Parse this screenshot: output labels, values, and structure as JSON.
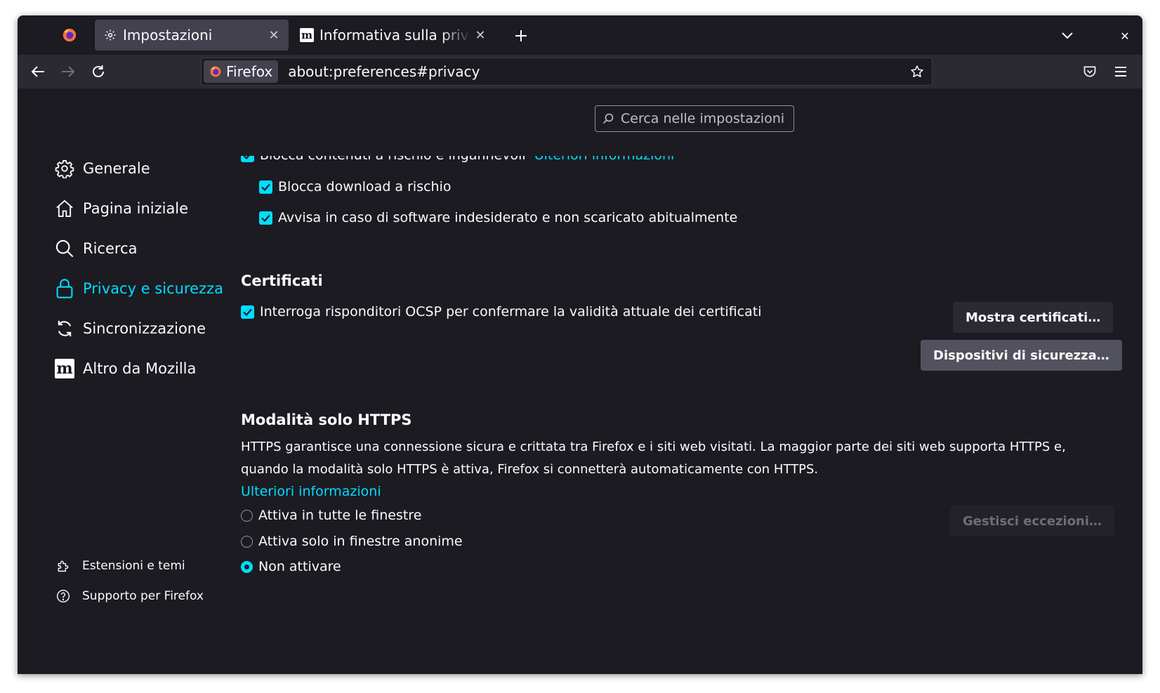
{
  "tabs": [
    {
      "title": "Impostazioni",
      "icon": "gear-icon"
    },
    {
      "title": "Informativa sulla privacy",
      "icon": "mozilla-m-icon"
    }
  ],
  "urlbar": {
    "identity_label": "Firefox",
    "url": "about:preferences#privacy"
  },
  "search": {
    "placeholder": "Cerca nelle impostazioni"
  },
  "sidebar": {
    "items": [
      {
        "label": "Generale",
        "icon": "gear-icon"
      },
      {
        "label": "Pagina iniziale",
        "icon": "home-icon"
      },
      {
        "label": "Ricerca",
        "icon": "search-icon"
      },
      {
        "label": "Privacy e sicurezza",
        "icon": "lock-icon",
        "selected": true
      },
      {
        "label": "Sincronizzazione",
        "icon": "sync-icon"
      },
      {
        "label": "Altro da Mozilla",
        "icon": "mozilla-m-icon"
      }
    ],
    "footer": [
      {
        "label": "Estensioni e temi",
        "icon": "puzzle-icon"
      },
      {
        "label": "Supporto per Firefox",
        "icon": "help-icon"
      }
    ]
  },
  "security": {
    "block_dangerous": {
      "label": "Blocca contenuti a rischio e ingannevoli",
      "link": "Ulteriori informazioni",
      "checked": true
    },
    "block_downloads": {
      "label": "Blocca download a rischio",
      "checked": true
    },
    "warn_unwanted": {
      "label": "Avvisa in caso di software indesiderato e non scaricato abitualmente",
      "checked": true
    }
  },
  "certificates": {
    "heading": "Certificati",
    "ocsp_label": "Interroga risponditori OCSP per confermare la validità attuale dei certificati",
    "ocsp_checked": true,
    "view_button": "Mostra certificati…",
    "devices_button": "Dispositivi di sicurezza…"
  },
  "https_only": {
    "heading": "Modalità solo HTTPS",
    "description": "HTTPS garantisce una connessione sicura e crittata tra Firefox e i siti web visitati. La maggior parte dei siti web supporta HTTPS e, quando la modalità solo HTTPS è attiva, Firefox si connetterà automaticamente con HTTPS.",
    "learn_more": "Ulteriori informazioni",
    "options": [
      {
        "label": "Attiva in tutte le finestre",
        "selected": false
      },
      {
        "label": "Attiva solo in finestre anonime",
        "selected": false
      },
      {
        "label": "Non attivare",
        "selected": true
      }
    ],
    "exceptions_button": "Gestisci eccezioni…"
  },
  "colors": {
    "accent": "#00ddff",
    "background": "#1c1b22",
    "toolbar": "#2b2a33",
    "active_tab": "#42414d"
  }
}
